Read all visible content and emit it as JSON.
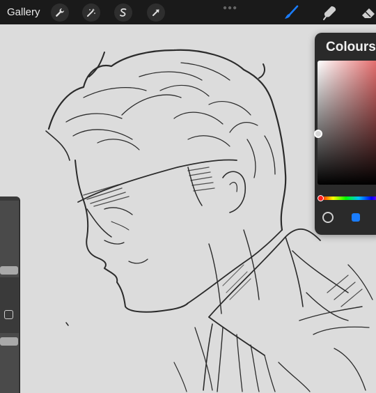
{
  "toolbar": {
    "gallery_label": "Gallery",
    "actions_icon": "wrench-icon",
    "adjustments_icon": "magic-wand-icon",
    "selection_icon": "selection-s-icon",
    "transform_icon": "arrow-cursor-icon",
    "brush_icon": "brush-icon",
    "smudge_icon": "smudge-icon",
    "eraser_icon": "eraser-icon",
    "active_tool_color": "#1a7dff"
  },
  "sidebar": {
    "brush_size_level": 0.6,
    "opacity_level": 0.6,
    "modify_icon": "square-icon"
  },
  "colours_panel": {
    "title": "Colours",
    "selected_hue_color": "#e05a5a",
    "mode_circle_icon": "circle-icon",
    "mode_square_icon": "square-icon",
    "accent_color": "#1a7dff"
  }
}
